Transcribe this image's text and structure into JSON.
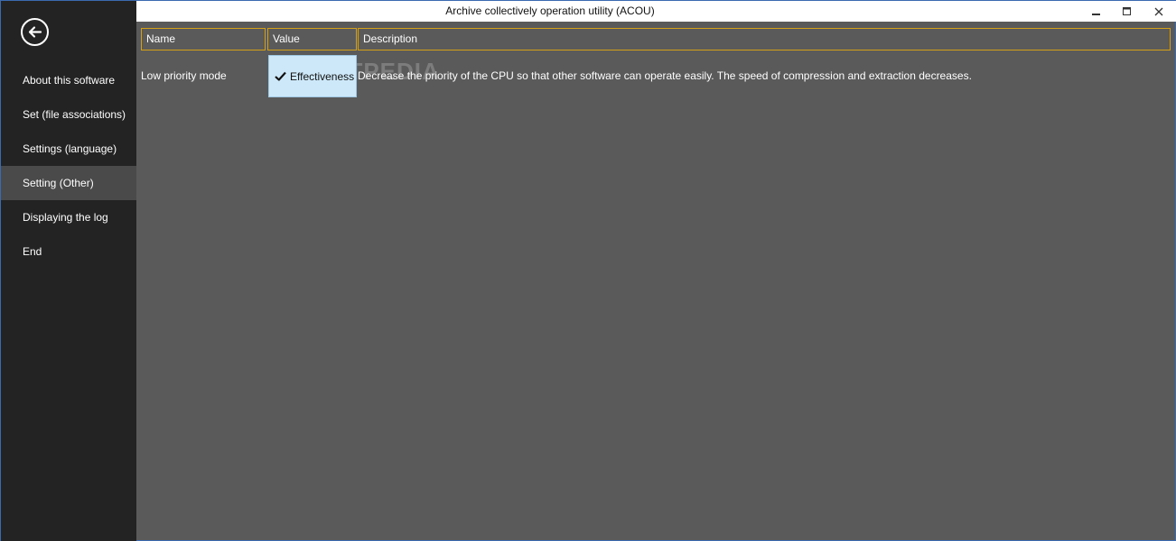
{
  "window": {
    "title": "Archive collectively operation utility (ACOU)"
  },
  "sidebar": {
    "back_icon": "back-arrow-icon",
    "items": [
      {
        "label": "About this software",
        "active": false
      },
      {
        "label": "Set (file associations)",
        "active": false
      },
      {
        "label": "Settings (language)",
        "active": false
      },
      {
        "label": "Setting (Other)",
        "active": true
      },
      {
        "label": "Displaying the log",
        "active": false
      },
      {
        "label": "End",
        "active": false
      }
    ]
  },
  "table": {
    "columns": [
      "Name",
      "Value",
      "Description"
    ],
    "rows": [
      {
        "name": "Low priority mode",
        "value": "Effectiveness",
        "checked": true,
        "description": "Decrease the priority of the CPU so that other software can operate easily. The speed of compression and extraction decreases."
      }
    ]
  },
  "watermark": "SOFTPEDIA",
  "colors": {
    "sidebar_bg": "#232323",
    "content_bg": "#5a5a5a",
    "header_border": "#d4a017",
    "toggle_bg": "#cde8f8",
    "active_item_bg": "#4a4a4a"
  }
}
